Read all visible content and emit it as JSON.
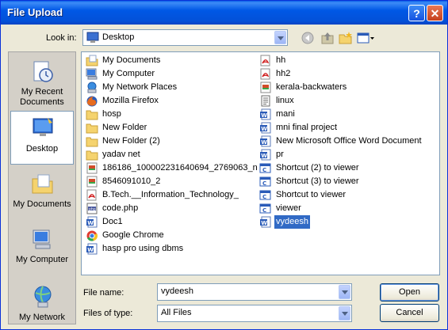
{
  "window": {
    "title": "File Upload",
    "help_label": "?",
    "close_label": "✕"
  },
  "toolbar": {
    "look_in_label": "Look in:",
    "look_in_value": "Desktop",
    "tools": [
      "back-icon",
      "up-folder-icon",
      "new-folder-icon",
      "views-menu-icon"
    ]
  },
  "places": [
    {
      "label": "My Recent Documents",
      "icon": "recent-documents-icon",
      "selected": false
    },
    {
      "label": "Desktop",
      "icon": "desktop-icon",
      "selected": true
    },
    {
      "label": "My Documents",
      "icon": "my-documents-icon",
      "selected": false
    },
    {
      "label": "My Computer",
      "icon": "my-computer-icon",
      "selected": false
    },
    {
      "label": "My Network",
      "icon": "my-network-icon",
      "selected": false
    }
  ],
  "files": {
    "left": [
      {
        "name": "My Documents",
        "icon": "my-documents"
      },
      {
        "name": "My Computer",
        "icon": "my-computer"
      },
      {
        "name": "My Network Places",
        "icon": "network"
      },
      {
        "name": "Mozilla Firefox",
        "icon": "firefox"
      },
      {
        "name": "hosp",
        "icon": "folder"
      },
      {
        "name": "New Folder",
        "icon": "folder"
      },
      {
        "name": "New Folder (2)",
        "icon": "folder"
      },
      {
        "name": "yadav net",
        "icon": "folder"
      },
      {
        "name": "186186_100002231640694_2769063_n",
        "icon": "image"
      },
      {
        "name": "8546091010_2",
        "icon": "image"
      },
      {
        "name": "B.Tech.__Information_Technology_",
        "icon": "pdf"
      },
      {
        "name": "code.php",
        "icon": "php"
      },
      {
        "name": "Doc1",
        "icon": "word"
      },
      {
        "name": "Google Chrome",
        "icon": "chrome"
      },
      {
        "name": "hasp pro using dbms",
        "icon": "word"
      }
    ],
    "right": [
      {
        "name": "hh",
        "icon": "pdf"
      },
      {
        "name": "hh2",
        "icon": "pdf"
      },
      {
        "name": "kerala-backwaters",
        "icon": "image"
      },
      {
        "name": "linux",
        "icon": "text"
      },
      {
        "name": "mani",
        "icon": "word"
      },
      {
        "name": "mni final project",
        "icon": "word"
      },
      {
        "name": "New Microsoft Office Word Document",
        "icon": "word"
      },
      {
        "name": "pr",
        "icon": "word"
      },
      {
        "name": "Shortcut (2) to viewer",
        "icon": "exe"
      },
      {
        "name": "Shortcut (3) to viewer",
        "icon": "exe"
      },
      {
        "name": "Shortcut to viewer",
        "icon": "exe"
      },
      {
        "name": "viewer",
        "icon": "exe"
      },
      {
        "name": "vydeesh",
        "icon": "word",
        "selected": true
      }
    ]
  },
  "form": {
    "file_name_label": "File name:",
    "file_name_value": "vydeesh",
    "file_type_label": "Files of type:",
    "file_type_value": "All Files",
    "open_label": "Open",
    "cancel_label": "Cancel"
  },
  "colors": {
    "selection": "#316ac5",
    "titlebar": "#0058e6",
    "dialog_bg": "#ece9d8"
  }
}
